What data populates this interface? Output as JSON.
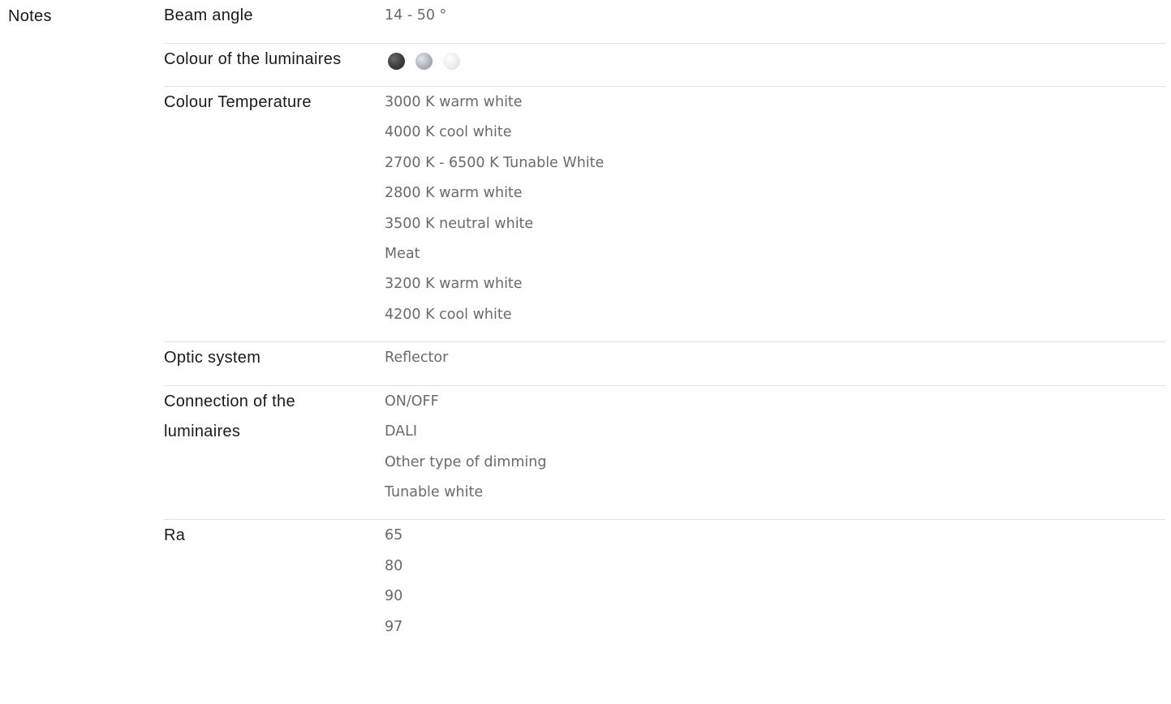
{
  "section": {
    "label": "Notes"
  },
  "specs": [
    {
      "name": "Beam angle",
      "values": [
        "14 - 50 °"
      ]
    },
    {
      "name": "Colour of the luminaires",
      "swatches": [
        {
          "name": "dark-grey",
          "color": "#404040",
          "gradient": "radial-gradient(circle at 35% 35%, #6a6a6a 0%, #3b3b3b 55%, #2a2a2a 100%)"
        },
        {
          "name": "silver",
          "color": "#a9afb5",
          "gradient": "radial-gradient(circle at 35% 35%, #e4e7ea 0%, #adb3b9 55%, #8e959b 100%)"
        },
        {
          "name": "white",
          "color": "#e8e8e8",
          "gradient": "radial-gradient(circle at 35% 35%, #ffffff 0%, #ececec 55%, #d6d6d6 100%)"
        }
      ]
    },
    {
      "name": "Colour Temperature",
      "values": [
        "3000 K warm white",
        "4000 K cool white",
        "2700 K - 6500 K Tunable White",
        "2800 K warm white",
        "3500 K neutral white",
        "Meat",
        "3200 K warm white",
        "4200 K cool white"
      ]
    },
    {
      "name": "Optic system",
      "values": [
        "Reflector"
      ]
    },
    {
      "name": "Connection of the luminaires",
      "values": [
        "ON/OFF",
        "DALI",
        "Other type of dimming",
        "Tunable white"
      ]
    },
    {
      "name": "Ra",
      "values": [
        "65",
        "80",
        "90",
        "97"
      ]
    }
  ]
}
